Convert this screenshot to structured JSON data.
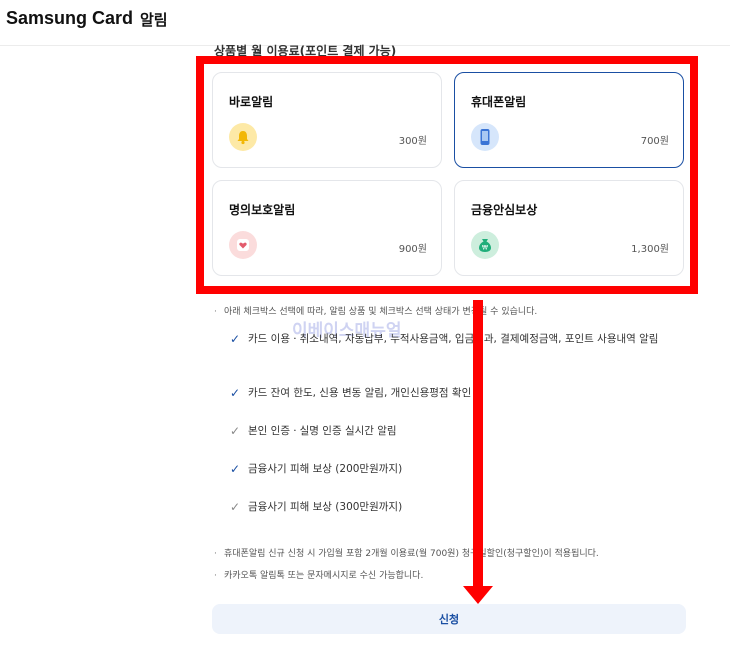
{
  "header": {
    "brand": "Samsung Card",
    "title": "알림"
  },
  "section_heading": "상품별 월 이용료(포인트 결제 가능)",
  "cards": [
    {
      "title": "바로알림",
      "price": "300원",
      "icon": "bell-icon",
      "icon_bg": "#fde9a6",
      "selected": false
    },
    {
      "title": "휴대폰알림",
      "price": "700원",
      "icon": "phone-icon",
      "icon_bg": "#d6e6fb",
      "selected": true
    },
    {
      "title": "명의보호알림",
      "price": "900원",
      "icon": "shield-heart-icon",
      "icon_bg": "#fbdcdc",
      "selected": false
    },
    {
      "title": "금융안심보상",
      "price": "1,300원",
      "icon": "money-bag-icon",
      "icon_bg": "#cdeedd",
      "selected": false
    }
  ],
  "notes": {
    "intro": "아래 체크박스 선택에 따라, 알림 상품 및 체크박스 선택 상태가 변경될 수 있습니다."
  },
  "checklist": [
    {
      "text": "카드 이용ㆍ취소내역, 자동납부, 누적사용금액, 입금결과, 결제예정금액, 포인트 사용내역 알림",
      "active": true
    },
    {
      "text": "카드 잔여 한도, 신용 변동 알림, 개인신용평점 확인",
      "active": true
    },
    {
      "text": "본인 인증ㆍ실명 인증 실시간 알림",
      "active": false
    },
    {
      "text": "금융사기 피해 보상 (200만원까지)",
      "active": true
    },
    {
      "text": "금융사기 피해 보상 (300만원까지)",
      "active": false
    }
  ],
  "footnotes": [
    "휴대폰알림 신규 신청 시 가입월 포함 2개월 이용료(월 700원) 청구일할인(청구할인)이 적용됩니다.",
    "카카오톡 알림톡 또는 문자메시지로 수신 가능합니다."
  ],
  "watermark": "이베이스매뉴얼",
  "apply_label": "신청",
  "colors": {
    "accent": "#1a4fa3",
    "annotation": "#ff0000"
  }
}
